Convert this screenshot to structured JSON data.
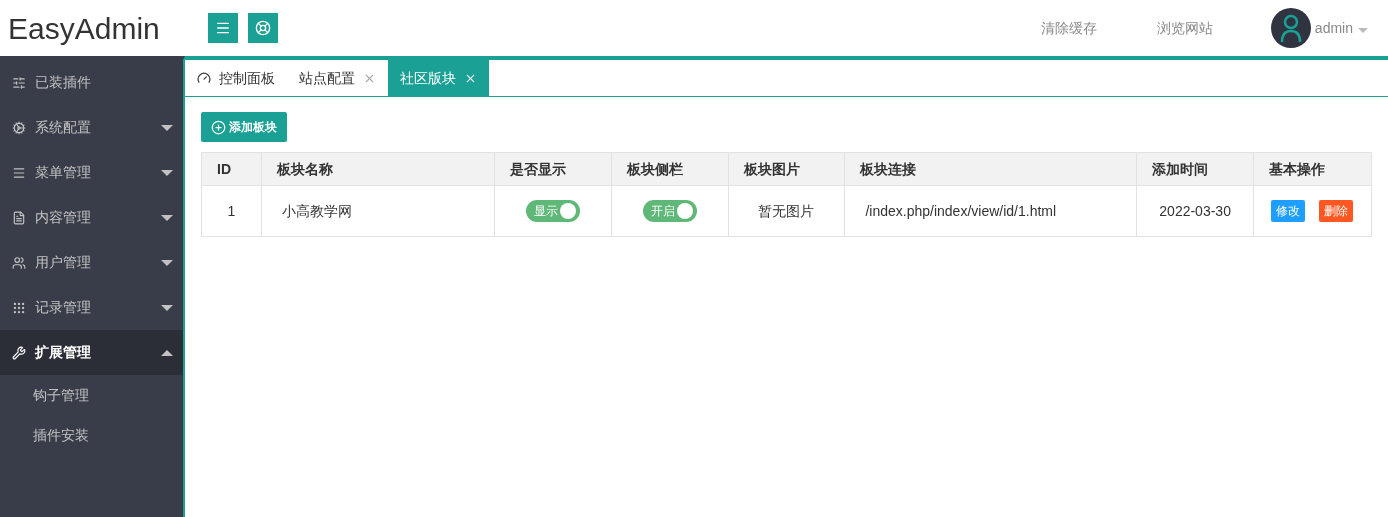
{
  "header": {
    "logo": "EasyAdmin",
    "links": [
      "清除缓存",
      "浏览网站"
    ],
    "user": "admin"
  },
  "sidebar": {
    "items": [
      {
        "label": "已装插件",
        "kind": "link",
        "expanded": false
      },
      {
        "label": "系统配置",
        "kind": "menu",
        "expanded": false
      },
      {
        "label": "菜单管理",
        "kind": "menu",
        "expanded": false
      },
      {
        "label": "内容管理",
        "kind": "menu",
        "expanded": false
      },
      {
        "label": "用户管理",
        "kind": "menu",
        "expanded": false
      },
      {
        "label": "记录管理",
        "kind": "menu",
        "expanded": false
      },
      {
        "label": "扩展管理",
        "kind": "menu",
        "expanded": true,
        "children": [
          {
            "label": "钩子管理"
          },
          {
            "label": "插件安装"
          }
        ]
      }
    ]
  },
  "tabs": [
    {
      "label": "控制面板",
      "kind": "home",
      "selected": false
    },
    {
      "label": "站点配置",
      "kind": "page",
      "selected": false
    },
    {
      "label": "社区版块",
      "kind": "page",
      "selected": true
    }
  ],
  "add_button": "添加板块",
  "table": {
    "columns": [
      "ID",
      "板块名称",
      "是否显示",
      "板块侧栏",
      "板块图片",
      "板块连接",
      "添加时间",
      "基本操作"
    ],
    "rows": [
      {
        "id": "1",
        "name": "小高教学网",
        "show": {
          "label": "显示",
          "on": true
        },
        "sidebar": {
          "label": "开启",
          "on": true
        },
        "image": "暂无图片",
        "link": "/index.php/index/view/id/1.html",
        "time": "2022-03-30",
        "actions": [
          {
            "label": "修改",
            "kind": "edit"
          },
          {
            "label": "删除",
            "kind": "delete"
          }
        ]
      }
    ]
  }
}
